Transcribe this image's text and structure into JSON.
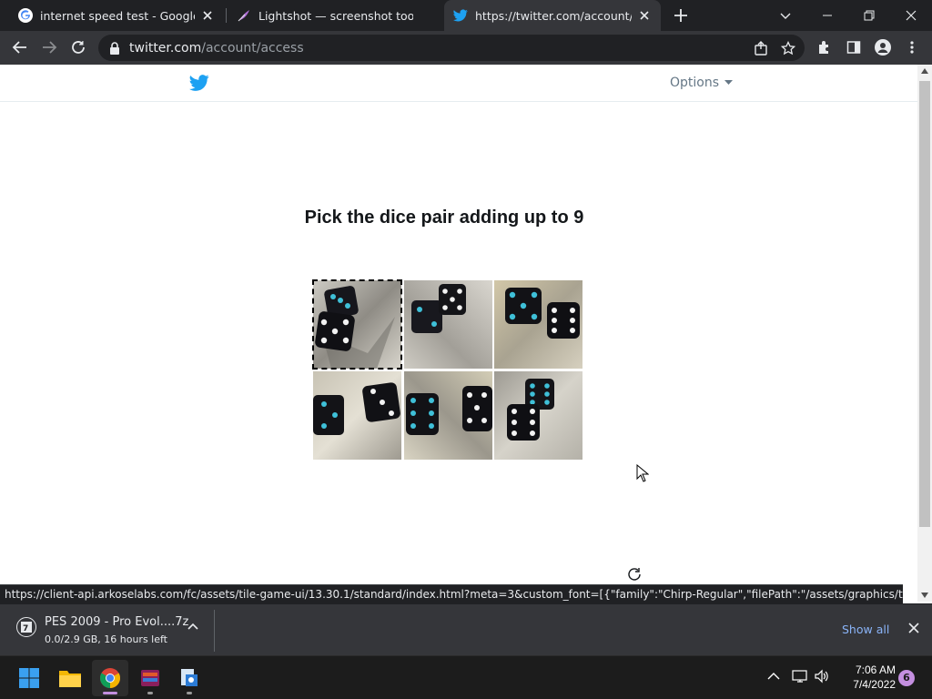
{
  "browser": {
    "tabs": [
      {
        "title": "internet speed test - Google Search",
        "icon": "google-icon",
        "active": false
      },
      {
        "title": "Lightshot — screenshot tool for Mac & Win",
        "icon": "lightshot-feather-icon",
        "active": false
      },
      {
        "title": "https://twitter.com/account/access",
        "icon": "twitter-bird-icon",
        "active": true
      }
    ],
    "url_host": "twitter.com",
    "url_path": "/account/access"
  },
  "page": {
    "options_label": "Options",
    "challenge_title": "Pick the dice pair adding up to 9",
    "tiles": [
      {
        "selected": true
      },
      {
        "selected": false
      },
      {
        "selected": false
      },
      {
        "selected": false
      },
      {
        "selected": false
      },
      {
        "selected": false
      }
    ]
  },
  "status_url": "https://client-api.arkoselabs.com/fc/assets/tile-game-ui/13.30.1/standard/index.html?meta=3&custom_font=[{\"family\":\"Chirp-Regular\",\"filePath\":\"/assets/graphics/twitter/Chirp-Regular...",
  "download": {
    "name": "PES 2009 - Pro Evol....7z",
    "status": "0.0/2.9 GB, 16 hours left",
    "show_all_label": "Show all"
  },
  "taskbar": {
    "time": "7:06 AM",
    "date": "7/4/2022",
    "notification_count": "6"
  },
  "colors": {
    "twitter_blue": "#1da1f2",
    "chrome_dark": "#202124",
    "chrome_toolbar": "#35363a",
    "link_blue": "#8ab4f8"
  }
}
